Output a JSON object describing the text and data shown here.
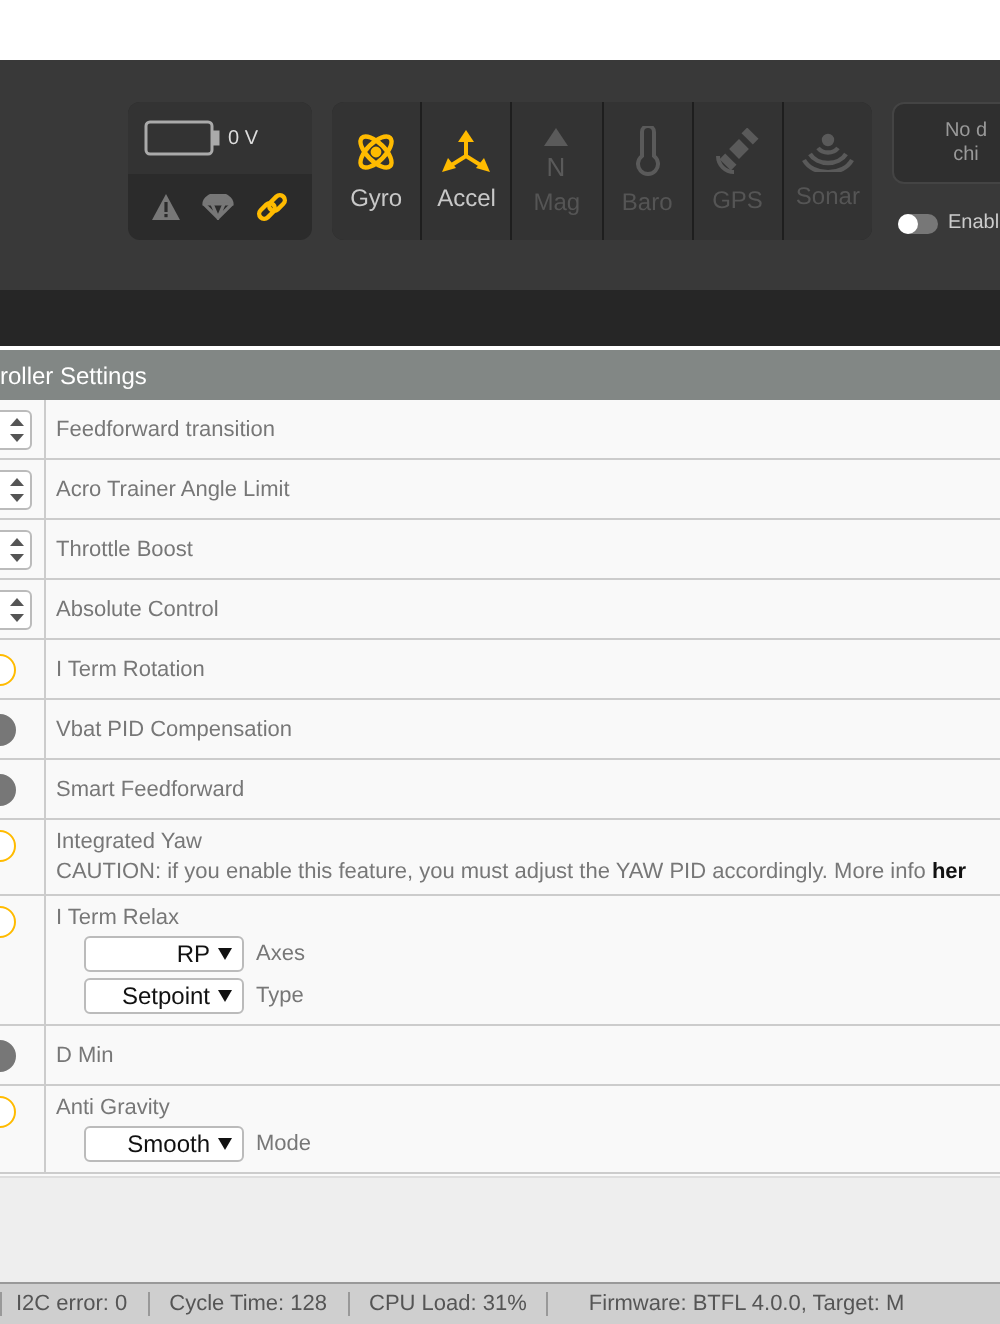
{
  "battery": {
    "reading": "0 V",
    "indicators": [
      {
        "kind": "warning",
        "active": false
      },
      {
        "kind": "parachute",
        "active": false
      },
      {
        "kind": "link",
        "active": true
      }
    ]
  },
  "sensors": [
    {
      "kind": "gyro",
      "label": "Gyro",
      "active": true
    },
    {
      "kind": "accel",
      "label": "Accel",
      "active": true
    },
    {
      "kind": "mag",
      "label": "Mag",
      "active": false,
      "icon_text": "N"
    },
    {
      "kind": "baro",
      "label": "Baro",
      "active": false
    },
    {
      "kind": "gps",
      "label": "GPS",
      "active": false
    },
    {
      "kind": "sonar",
      "label": "Sonar",
      "active": false
    }
  ],
  "dataflash": {
    "lines": [
      "No d",
      "chi"
    ]
  },
  "expert_toggle": {
    "label": "Enabl",
    "on": false
  },
  "section": {
    "title": "roller Settings"
  },
  "settings": [
    {
      "kind": "number",
      "label": "Feedforward transition"
    },
    {
      "kind": "number",
      "label": "Acro Trainer Angle Limit"
    },
    {
      "kind": "number",
      "label": "Throttle Boost"
    },
    {
      "kind": "number",
      "label": "Absolute Control"
    },
    {
      "kind": "toggle",
      "label": "I Term Rotation",
      "on": true
    },
    {
      "kind": "toggle",
      "label": "Vbat PID Compensation",
      "on": false
    },
    {
      "kind": "toggle",
      "label": "Smart Feedforward",
      "on": false
    },
    {
      "kind": "toggle",
      "label": "Integrated Yaw",
      "on": true,
      "note": "CAUTION: if you enable this feature, you must adjust the YAW PID accordingly. More info **her**"
    },
    {
      "kind": "toggle",
      "label": "I Term Relax",
      "on": true,
      "selects": [
        {
          "value": "RP",
          "label": "Axes"
        },
        {
          "value": "Setpoint",
          "label": "Type"
        }
      ]
    },
    {
      "kind": "toggle",
      "label": "D Min",
      "on": false
    },
    {
      "kind": "toggle",
      "label": "Anti Gravity",
      "on": true,
      "selects": [
        {
          "value": "Smooth",
          "label": "Mode"
        }
      ]
    }
  ],
  "status_bar": [
    "I2C error: 0",
    "Cycle Time: 128",
    "CPU Load: 31%",
    "Firmware: BTFL 4.0.0, Target: M"
  ]
}
